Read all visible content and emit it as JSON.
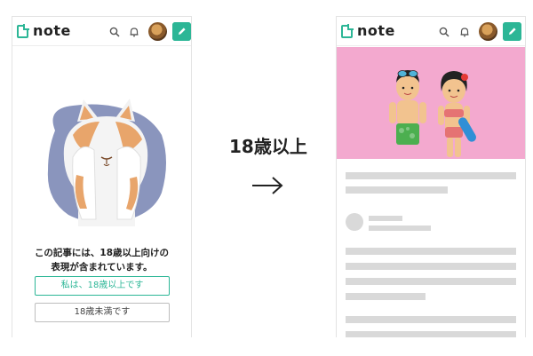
{
  "left_phone": {
    "logo_text": "note",
    "message_line1": "この記事には、18歳以上向けの",
    "message_line2": "表現が含まれています。",
    "button_yes": "私は、18歳以上です",
    "button_no": "18歳未満です"
  },
  "middle": {
    "label": "18歳以上"
  },
  "right_phone": {
    "logo_text": "note"
  },
  "colors": {
    "brand": "#2cb696",
    "banner_pink": "#f3a9cf",
    "skeleton": "#d9d9d9"
  },
  "icons": [
    "note-logo-icon",
    "search-icon",
    "bell-icon",
    "avatar",
    "edit-icon",
    "arrow-right-icon"
  ]
}
